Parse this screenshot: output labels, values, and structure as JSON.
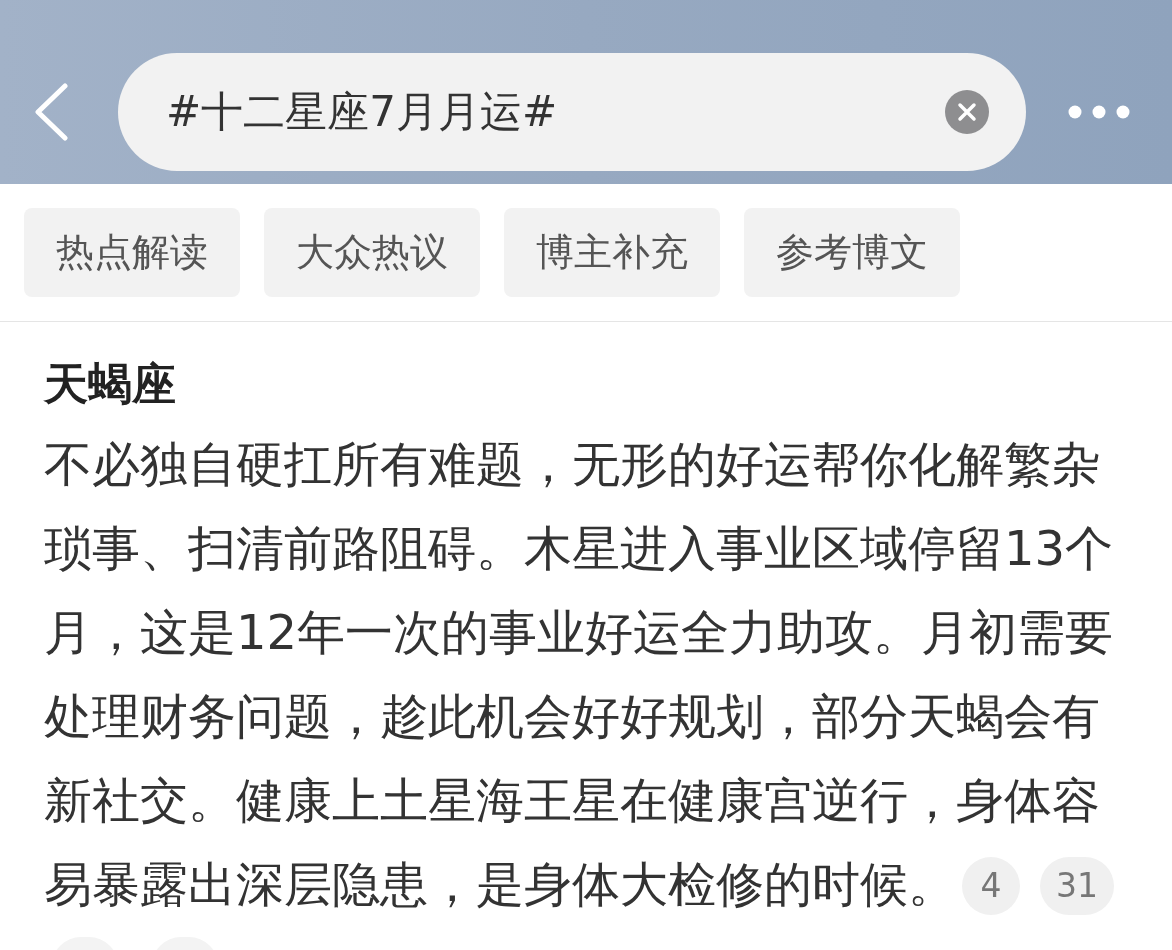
{
  "header": {
    "search": {
      "value": "#十二星座7月月运#"
    }
  },
  "tabs": [
    {
      "label": "热点解读"
    },
    {
      "label": "大众热议"
    },
    {
      "label": "博主补充"
    },
    {
      "label": "参考博文"
    }
  ],
  "article": {
    "title": "天蝎座",
    "paragraph": "不必独自硬扛所有难题，无形的好运帮你化解繁杂琐事、扫清前路阻碍。木星进入事业区域停留13个月，这是12年一次的事业好运全力助攻。月初需要处理财务问题，趁此机会好好规划，部分天蝎会有新社交。健康上土星海王星在健康宫逆行，身体容易暴露出深层隐患，是身体大检修的时候。",
    "citations": [
      "4",
      "31"
    ]
  }
}
